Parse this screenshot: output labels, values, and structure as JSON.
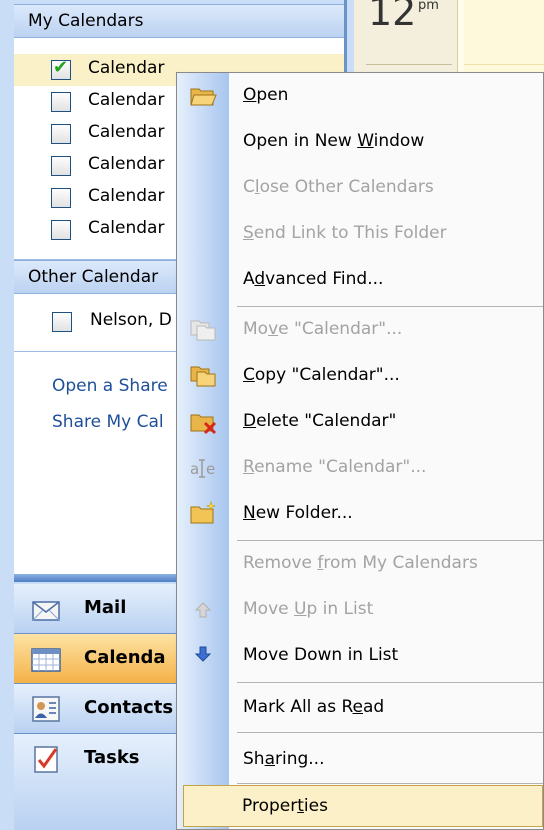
{
  "my_calendars": {
    "header": "My Calendars",
    "items": [
      {
        "label": "Calendar",
        "checked": true
      },
      {
        "label": "Calendar",
        "checked": false
      },
      {
        "label": "Calendar",
        "checked": false
      },
      {
        "label": "Calendar",
        "checked": false
      },
      {
        "label": "Calendar",
        "checked": false
      },
      {
        "label": "Calendar",
        "checked": false
      }
    ]
  },
  "other_calendars": {
    "header": "Other Calendar",
    "items": [
      {
        "label": "Nelson, D",
        "checked": false
      }
    ]
  },
  "links": {
    "open_shared": "Open a Share",
    "share_my": "Share My Cal"
  },
  "nav_buttons": [
    {
      "label": "Mail",
      "icon": "mail-icon"
    },
    {
      "label": "Calenda",
      "icon": "calendar-icon",
      "active": true
    },
    {
      "label": "Contacts",
      "icon": "contacts-icon"
    },
    {
      "label": "Tasks",
      "icon": "tasks-icon"
    }
  ],
  "calendar_view": {
    "hour": "12",
    "ampm": "pm"
  },
  "context_menu": {
    "items": [
      {
        "pre": "",
        "key": "O",
        "post": "pen",
        "icon": "open-folder-icon",
        "enabled": true
      },
      {
        "pre": "Open in New ",
        "key": "W",
        "post": "indow",
        "icon": "",
        "enabled": true
      },
      {
        "pre": "C",
        "key": "l",
        "post": "ose Other Calendars",
        "icon": "",
        "enabled": false
      },
      {
        "pre": "",
        "key": "S",
        "post": "end Link to This Folder",
        "icon": "",
        "enabled": false
      },
      {
        "pre": "A",
        "key": "d",
        "post": "vanced Find...",
        "icon": "",
        "enabled": true
      },
      {
        "pre": "Mo",
        "key": "v",
        "post": "e \"Calendar\"...",
        "icon": "move-folder-icon",
        "enabled": false
      },
      {
        "pre": "",
        "key": "C",
        "post": "opy \"Calendar\"...",
        "icon": "copy-folder-icon",
        "enabled": true
      },
      {
        "pre": "",
        "key": "D",
        "post": "elete \"Calendar\"",
        "icon": "delete-folder-icon",
        "enabled": true
      },
      {
        "pre": "",
        "key": "R",
        "post": "ename \"Calendar\"...",
        "icon": "rename-icon",
        "enabled": false
      },
      {
        "pre": "",
        "key": "N",
        "post": "ew Folder...",
        "icon": "new-folder-icon",
        "enabled": true
      },
      {
        "pre": "Remove ",
        "key": "f",
        "post": "rom My Calendars",
        "icon": "",
        "enabled": false
      },
      {
        "pre": "Move ",
        "key": "U",
        "post": "p in List",
        "icon": "arrow-up-icon",
        "enabled": false
      },
      {
        "pre": "Move Down in List",
        "key": "",
        "post": "",
        "icon": "arrow-down-icon",
        "enabled": true
      },
      {
        "pre": "Mark All as R",
        "key": "e",
        "post": "ad",
        "icon": "",
        "enabled": true
      },
      {
        "pre": "Sh",
        "key": "a",
        "post": "ring...",
        "icon": "",
        "enabled": true
      },
      {
        "pre": "Proper",
        "key": "t",
        "post": "ies",
        "icon": "",
        "enabled": true,
        "highlighted": true
      }
    ]
  },
  "colors": {
    "nav_background": "#c9ddf7",
    "selected_row": "#fbf1c8",
    "active_nav_button": "#f4b248",
    "link": "#1f4f9a",
    "menu_highlight": "#fcf0c8",
    "disabled_text": "#a3a3a3"
  }
}
